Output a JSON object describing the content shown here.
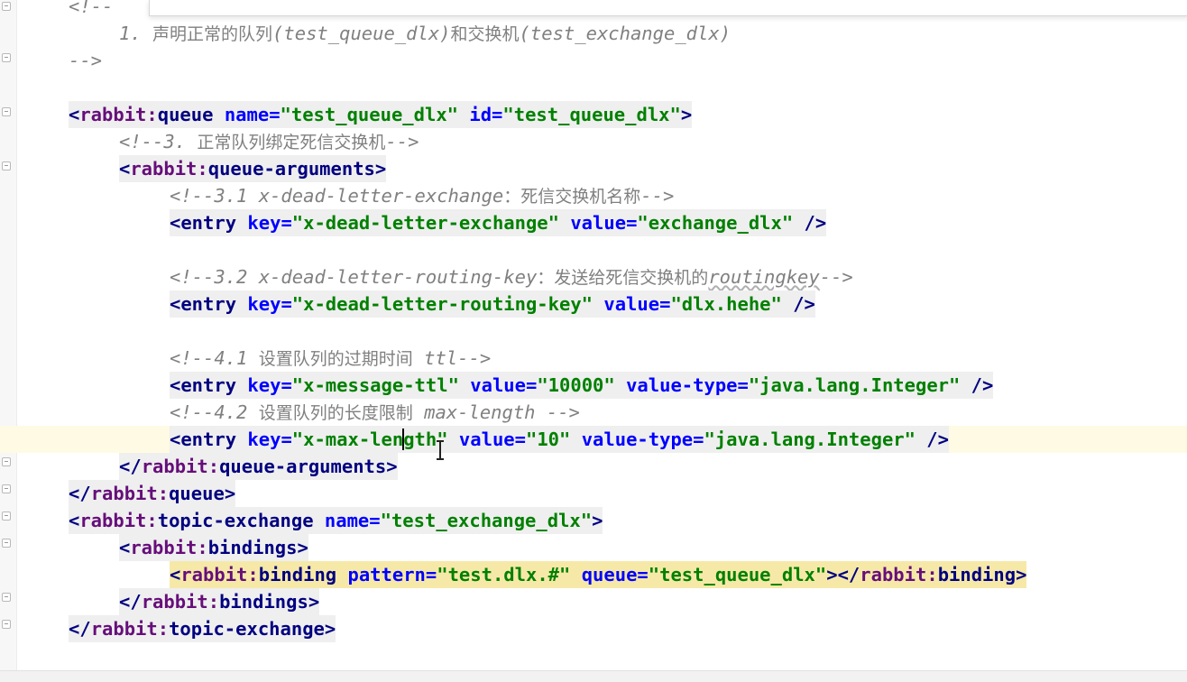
{
  "editor": {
    "lines": [
      {
        "kind": "comment",
        "text": "<!--"
      },
      {
        "kind": "comment",
        "text": "1. 声明正常的队列(test_queue_dlx)和交换机(test_exchange_dlx)"
      },
      {
        "kind": "comment",
        "text": "-->"
      },
      {
        "kind": "open",
        "ns": "rabbit",
        "tag": "queue",
        "attrs": [
          {
            "name": "name",
            "value": "test_queue_dlx"
          },
          {
            "name": "id",
            "value": "test_queue_dlx"
          }
        ]
      },
      {
        "kind": "comment",
        "text": "<!--3. 正常队列绑定死信交换机-->"
      },
      {
        "kind": "open",
        "ns": "rabbit",
        "tag": "queue-arguments"
      },
      {
        "kind": "comment",
        "text": "<!--3.1 x-dead-letter-exchange：死信交换机名称-->"
      },
      {
        "kind": "selfclose",
        "tag": "entry",
        "attrs": [
          {
            "name": "key",
            "value": "x-dead-letter-exchange"
          },
          {
            "name": "value",
            "value": "exchange_dlx"
          }
        ]
      },
      {
        "kind": "comment",
        "text": "<!--3.2 x-dead-letter-routing-key：发送给死信交换机的routingkey-->"
      },
      {
        "kind": "selfclose",
        "tag": "entry",
        "attrs": [
          {
            "name": "key",
            "value": "x-dead-letter-routing-key"
          },
          {
            "name": "value",
            "value": "dlx.hehe"
          }
        ]
      },
      {
        "kind": "comment",
        "text": "<!--4.1 设置队列的过期时间 ttl-->"
      },
      {
        "kind": "selfclose",
        "tag": "entry",
        "attrs": [
          {
            "name": "key",
            "value": "x-message-ttl"
          },
          {
            "name": "value",
            "value": "10000"
          },
          {
            "name": "value-type",
            "value": "java.lang.Integer"
          }
        ]
      },
      {
        "kind": "comment",
        "text": "<!--4.2 设置队列的长度限制 max-length -->"
      },
      {
        "kind": "selfclose",
        "tag": "entry",
        "attrs": [
          {
            "name": "key",
            "value": "x-max-length"
          },
          {
            "name": "value",
            "value": "10"
          },
          {
            "name": "value-type",
            "value": "java.lang.Integer"
          }
        ]
      },
      {
        "kind": "close",
        "ns": "rabbit",
        "tag": "queue-arguments"
      },
      {
        "kind": "close",
        "ns": "rabbit",
        "tag": "queue"
      },
      {
        "kind": "open",
        "ns": "rabbit",
        "tag": "topic-exchange",
        "attrs": [
          {
            "name": "name",
            "value": "test_exchange_dlx"
          }
        ]
      },
      {
        "kind": "open",
        "ns": "rabbit",
        "tag": "bindings"
      },
      {
        "kind": "openclose",
        "ns": "rabbit",
        "tag": "binding",
        "attrs": [
          {
            "name": "pattern",
            "value": "test.dlx.#"
          },
          {
            "name": "queue",
            "value": "test_queue_dlx"
          }
        ]
      },
      {
        "kind": "close",
        "ns": "rabbit",
        "tag": "bindings"
      },
      {
        "kind": "close",
        "ns": "rabbit",
        "tag": "topic-exchange"
      }
    ]
  }
}
